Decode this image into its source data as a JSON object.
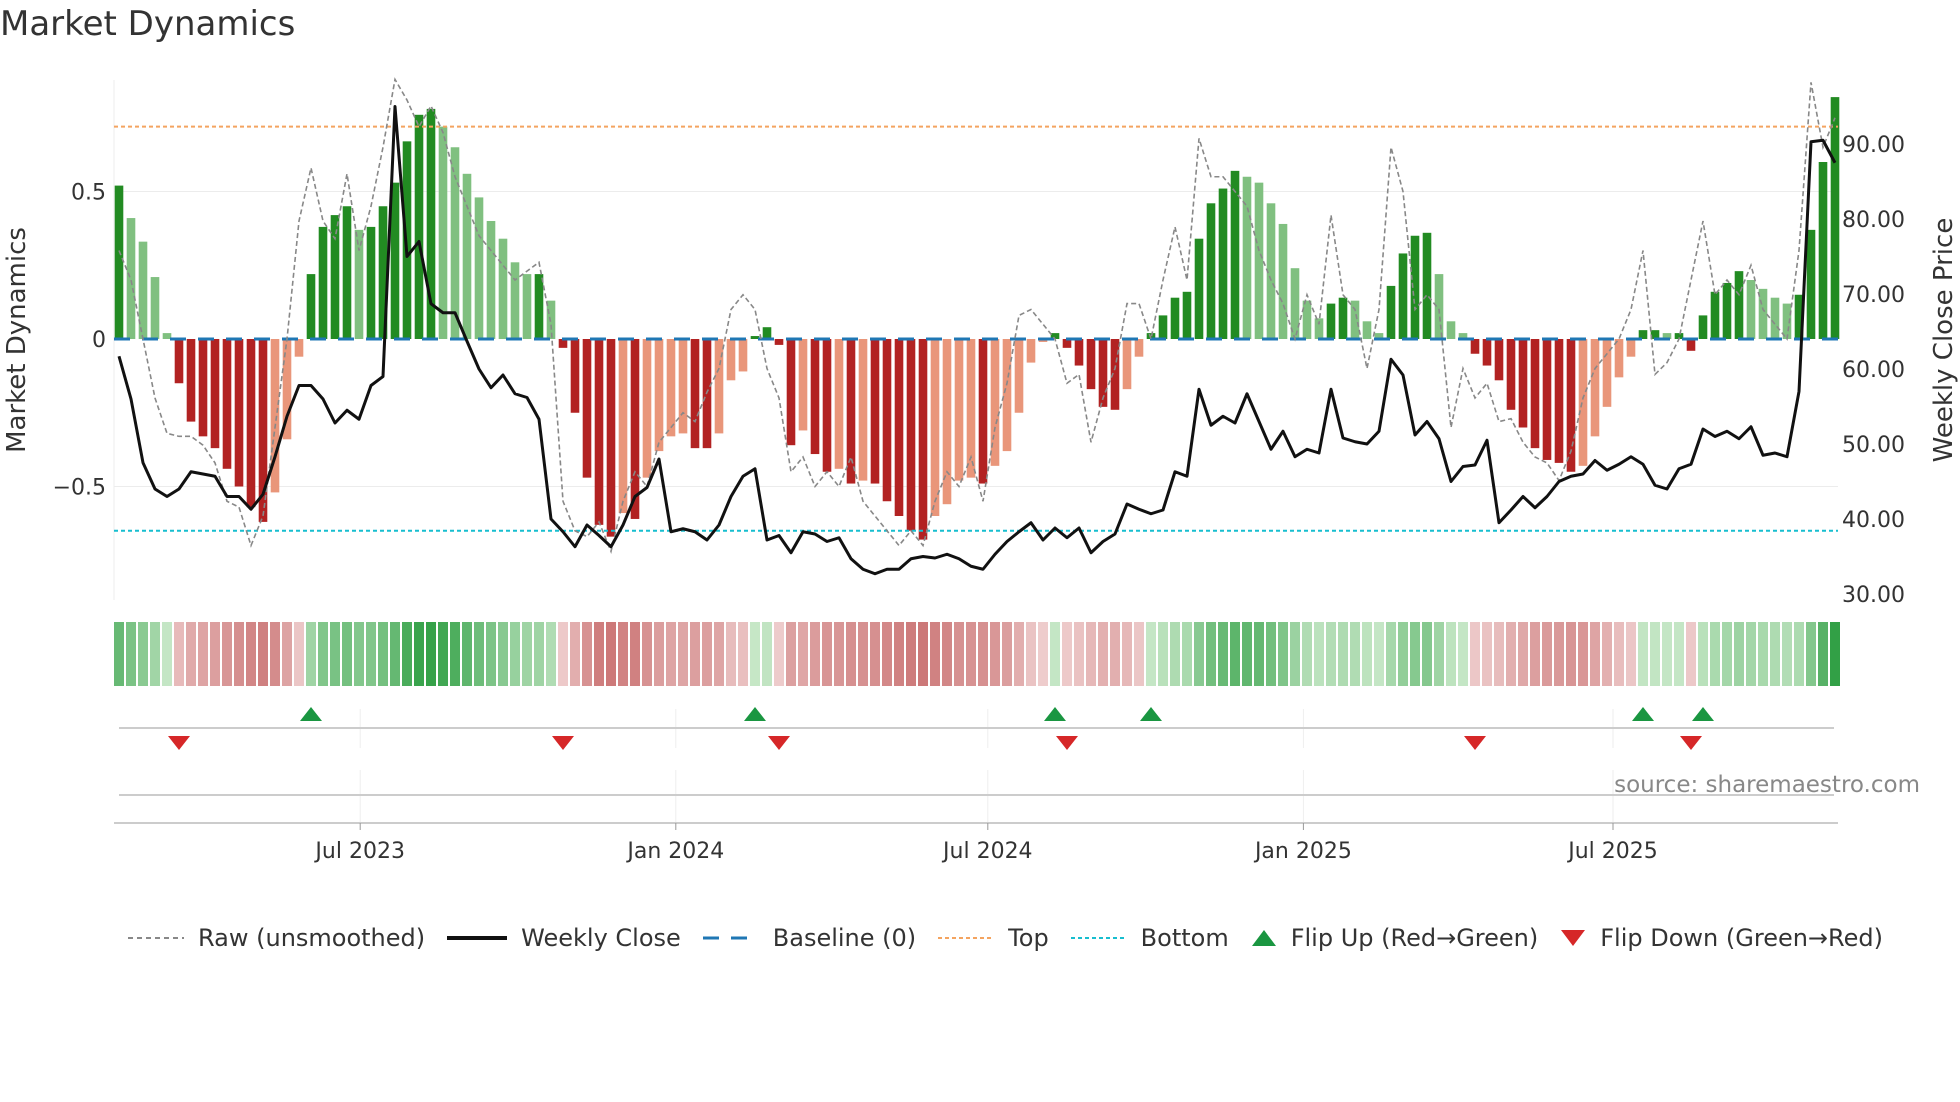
{
  "title": "Market Dynamics",
  "source": "source: sharemaestro.com",
  "legend": {
    "raw": "Raw (unsmoothed)",
    "close": "Weekly Close",
    "baseline": "Baseline (0)",
    "top": "Top",
    "bottom": "Bottom",
    "flip_up": "Flip Up (Red→Green)",
    "flip_down": "Flip Down (Green→Red)"
  },
  "colors": {
    "pos_rising": "#228b22",
    "pos_falling": "#80c080",
    "neg_falling": "#b22222",
    "neg_rising": "#e9967a",
    "raw": "#888888",
    "close": "#111111",
    "baseline": "#1f77b4",
    "top": "#f4a460",
    "bottom": "#17becf",
    "flip_up": "#1a9641",
    "flip_down": "#d62728"
  },
  "chart_data": {
    "type": "bar",
    "title": "Market Dynamics",
    "ylabel": "Market Dynamics",
    "y2label": "Weekly Close Price",
    "ylim": [
      -0.9,
      0.9
    ],
    "y2lim": [
      30,
      97
    ],
    "yticks": [
      {
        "v": 0.5,
        "label": "0.5"
      },
      {
        "v": 0,
        "label": "0"
      },
      {
        "v": -0.5,
        "label": "−0.5"
      }
    ],
    "y2ticks": [
      {
        "v": 90,
        "label": "90.00"
      },
      {
        "v": 80,
        "label": "80.00"
      },
      {
        "v": 70,
        "label": "70.00"
      },
      {
        "v": 60,
        "label": "60.00"
      },
      {
        "v": 50,
        "label": "50.00"
      },
      {
        "v": 40,
        "label": "40.00"
      },
      {
        "v": 30,
        "label": "30.00"
      }
    ],
    "xticks": [
      {
        "week": 20.1,
        "label": "Jul 2023"
      },
      {
        "week": 46.4,
        "label": "Jan 2024"
      },
      {
        "week": 72.4,
        "label": "Jul 2024"
      },
      {
        "week": 98.7,
        "label": "Jan 2025"
      },
      {
        "week": 124.5,
        "label": "Jul 2025"
      }
    ],
    "top": 0.72,
    "bottom": -0.65,
    "baseline": 0,
    "smoothed": [
      0.52,
      0.41,
      0.33,
      0.21,
      0.02,
      -0.15,
      -0.28,
      -0.33,
      -0.37,
      -0.44,
      -0.5,
      -0.57,
      -0.62,
      -0.52,
      -0.34,
      -0.06,
      0.22,
      0.38,
      0.42,
      0.45,
      0.37,
      0.38,
      0.45,
      0.53,
      0.67,
      0.76,
      0.78,
      0.72,
      0.65,
      0.56,
      0.48,
      0.4,
      0.34,
      0.26,
      0.22,
      0.22,
      0.13,
      -0.03,
      -0.25,
      -0.47,
      -0.63,
      -0.67,
      -0.59,
      -0.61,
      -0.47,
      -0.38,
      -0.33,
      -0.32,
      -0.37,
      -0.37,
      -0.32,
      -0.14,
      -0.11,
      0.01,
      0.04,
      -0.02,
      -0.36,
      -0.31,
      -0.39,
      -0.45,
      -0.44,
      -0.49,
      -0.48,
      -0.49,
      -0.55,
      -0.6,
      -0.65,
      -0.68,
      -0.6,
      -0.56,
      -0.48,
      -0.47,
      -0.49,
      -0.43,
      -0.38,
      -0.25,
      -0.08,
      -0.01,
      0.02,
      -0.03,
      -0.09,
      -0.17,
      -0.23,
      -0.24,
      -0.17,
      -0.06,
      0.02,
      0.08,
      0.14,
      0.16,
      0.34,
      0.46,
      0.51,
      0.57,
      0.55,
      0.53,
      0.46,
      0.39,
      0.24,
      0.13,
      0.07,
      0.12,
      0.14,
      0.13,
      0.06,
      0.02,
      0.18,
      0.29,
      0.35,
      0.36,
      0.22,
      0.06,
      0.02,
      -0.05,
      -0.09,
      -0.14,
      -0.24,
      -0.3,
      -0.37,
      -0.41,
      -0.42,
      -0.45,
      -0.43,
      -0.33,
      -0.23,
      -0.13,
      -0.06,
      0.03,
      0.03,
      0.02,
      0.02,
      -0.04,
      0.08,
      0.16,
      0.19,
      0.23,
      0.2,
      0.17,
      0.14,
      0.12,
      0.15,
      0.37,
      0.6,
      0.82
    ],
    "raw": [
      0.3,
      0.2,
      0.0,
      -0.2,
      -0.32,
      -0.33,
      -0.33,
      -0.36,
      -0.42,
      -0.55,
      -0.57,
      -0.7,
      -0.6,
      -0.3,
      0.0,
      0.4,
      0.58,
      0.4,
      0.34,
      0.56,
      0.3,
      0.45,
      0.65,
      0.88,
      0.81,
      0.72,
      0.79,
      0.7,
      0.55,
      0.45,
      0.35,
      0.3,
      0.25,
      0.2,
      0.23,
      0.26,
      0.05,
      -0.55,
      -0.65,
      -0.67,
      -0.62,
      -0.72,
      -0.55,
      -0.45,
      -0.5,
      -0.35,
      -0.3,
      -0.25,
      -0.28,
      -0.18,
      -0.1,
      0.1,
      0.15,
      0.1,
      -0.1,
      -0.2,
      -0.45,
      -0.4,
      -0.5,
      -0.45,
      -0.5,
      -0.4,
      -0.55,
      -0.6,
      -0.65,
      -0.7,
      -0.65,
      -0.7,
      -0.55,
      -0.45,
      -0.5,
      -0.4,
      -0.55,
      -0.3,
      -0.15,
      0.08,
      0.1,
      0.05,
      0.0,
      -0.15,
      -0.12,
      -0.35,
      -0.2,
      -0.1,
      0.12,
      0.12,
      0.0,
      0.2,
      0.38,
      0.2,
      0.68,
      0.55,
      0.55,
      0.5,
      0.45,
      0.3,
      0.2,
      0.12,
      0.0,
      0.15,
      0.05,
      0.42,
      0.15,
      0.1,
      -0.1,
      0.1,
      0.65,
      0.5,
      0.1,
      0.15,
      0.1,
      -0.3,
      -0.1,
      -0.2,
      -0.15,
      -0.28,
      -0.27,
      -0.35,
      -0.4,
      -0.42,
      -0.48,
      -0.38,
      -0.2,
      -0.1,
      -0.05,
      0.0,
      0.1,
      0.3,
      -0.12,
      -0.08,
      0.0,
      0.2,
      0.4,
      0.15,
      0.2,
      0.15,
      0.25,
      0.1,
      0.05,
      0.0,
      0.3,
      0.87,
      0.65,
      0.75
    ],
    "close": [
      61.7,
      56,
      47.5,
      44,
      43,
      44,
      46.3,
      46,
      45.7,
      43,
      43,
      41.3,
      43.3,
      48.3,
      53.7,
      57.8,
      57.8,
      56,
      52.8,
      54.5,
      53.3,
      57.8,
      59,
      95,
      75,
      77,
      68.7,
      67.5,
      67.5,
      63.7,
      60,
      57.5,
      59.2,
      56.7,
      56.2,
      53.3,
      40,
      38.3,
      36.3,
      39.2,
      37.8,
      36.3,
      39.2,
      43,
      44.2,
      48,
      38.3,
      38.7,
      38.3,
      37.2,
      39.2,
      43,
      45.7,
      46.7,
      37.2,
      37.8,
      35.5,
      38.3,
      38,
      37,
      37.5,
      34.7,
      33.3,
      32.7,
      33.3,
      33.3,
      34.7,
      35,
      34.8,
      35.3,
      34.7,
      33.7,
      33.3,
      35.3,
      37,
      38.3,
      39.5,
      37.2,
      38.8,
      37.5,
      38.8,
      35.5,
      37,
      38,
      42,
      41.3,
      40.7,
      41.2,
      46.3,
      45.7,
      57.3,
      52.5,
      53.7,
      52.8,
      56.7,
      53,
      49.3,
      51.7,
      48.3,
      49.3,
      48.8,
      57.3,
      50.8,
      50.3,
      50,
      51.7,
      61.3,
      59.2,
      51.2,
      53,
      50.7,
      45,
      47,
      47.2,
      50.5,
      39.5,
      41.2,
      43,
      41.5,
      43,
      45,
      45.7,
      46,
      47.8,
      46.5,
      47.3,
      48.3,
      47.3,
      44.5,
      44,
      46.7,
      47.3,
      52,
      51,
      51.7,
      50.7,
      52.3,
      48.5,
      48.8,
      48.3,
      57,
      90.3,
      90.5,
      87.5
    ],
    "flips_up": [
      16,
      53,
      78,
      86,
      127,
      132
    ],
    "flips_down": [
      5,
      37,
      55,
      79,
      113,
      131
    ]
  }
}
